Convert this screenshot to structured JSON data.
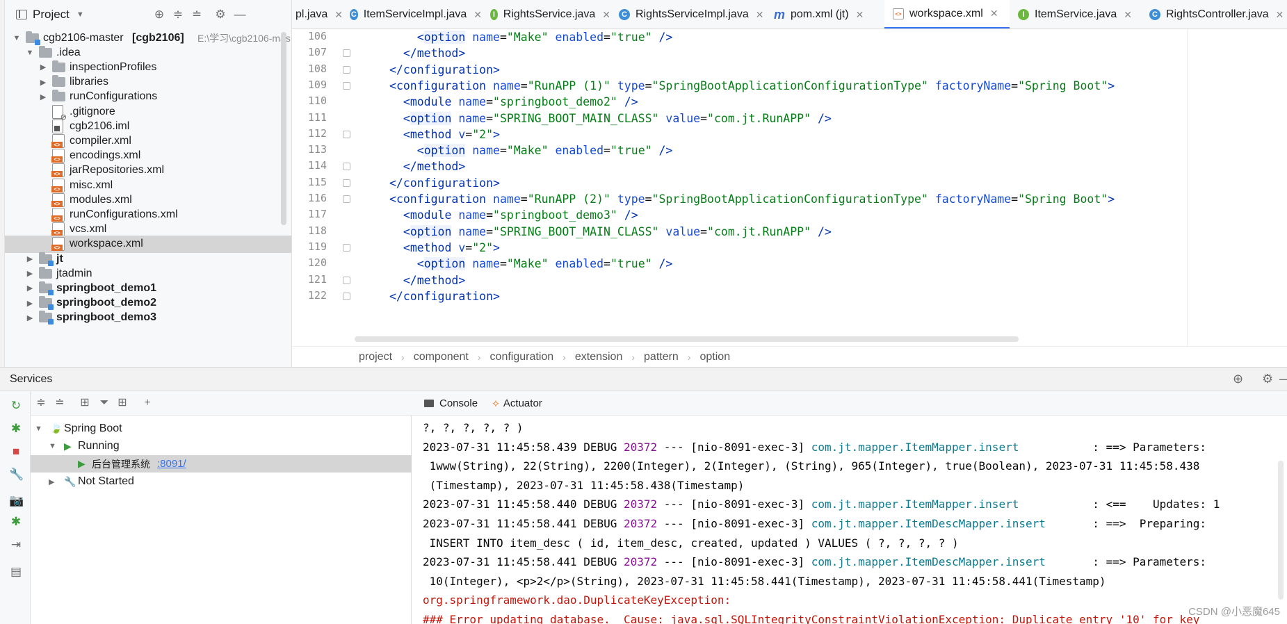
{
  "project_panel": {
    "title": "Project",
    "tree": [
      {
        "label": "cgb2106-master",
        "bold_suffix": "[cgb2106]",
        "path": "E:\\学习\\cgb2106-mas",
        "expanded": true
      },
      {
        "label": ".idea",
        "expanded": true
      },
      {
        "label": "inspectionProfiles"
      },
      {
        "label": "libraries"
      },
      {
        "label": "runConfigurations"
      },
      {
        "label": ".gitignore"
      },
      {
        "label": "cgb2106.iml"
      },
      {
        "label": "compiler.xml"
      },
      {
        "label": "encodings.xml"
      },
      {
        "label": "jarRepositories.xml"
      },
      {
        "label": "misc.xml"
      },
      {
        "label": "modules.xml"
      },
      {
        "label": "runConfigurations.xml"
      },
      {
        "label": "vcs.xml"
      },
      {
        "label": "workspace.xml",
        "selected": true
      },
      {
        "label": "jt"
      },
      {
        "label": "jtadmin"
      },
      {
        "label": "springboot_demo1"
      },
      {
        "label": "springboot_demo2"
      },
      {
        "label": "springboot_demo3"
      }
    ]
  },
  "tabs": [
    {
      "label": "pl.java",
      "icon": ""
    },
    {
      "label": "ItemServiceImpl.java",
      "icon": "C"
    },
    {
      "label": "RightsService.java",
      "icon": "I"
    },
    {
      "label": "RightsServiceImpl.java",
      "icon": "C"
    },
    {
      "label": "pom.xml (jt)",
      "icon": "m"
    },
    {
      "label": "workspace.xml",
      "icon": "xml",
      "active": true
    },
    {
      "label": "ItemService.java",
      "icon": "I"
    },
    {
      "label": "RightsController.java",
      "icon": "C"
    }
  ],
  "editor": {
    "line_numbers": [
      "106",
      "107",
      "108",
      "109",
      "110",
      "111",
      "112",
      "113",
      "114",
      "115",
      "116",
      "117",
      "118",
      "119",
      "120",
      "121",
      "122"
    ],
    "lines": [
      "    <option name=\"Make\" enabled=\"true\" />",
      "  </method>",
      "</configuration>",
      "<configuration name=\"RunAPP (1)\" type=\"SpringBootApplicationConfigurationType\" factoryName=\"Spring Boot\">",
      "  <module name=\"springboot_demo2\" />",
      "  <option name=\"SPRING_BOOT_MAIN_CLASS\" value=\"com.jt.RunAPP\" />",
      "  <method v=\"2\">",
      "    <option name=\"Make\" enabled=\"true\" />",
      "  </method>",
      "</configuration>",
      "<configuration name=\"RunAPP (2)\" type=\"SpringBootApplicationConfigurationType\" factoryName=\"Spring Boot\">",
      "  <module name=\"springboot_demo3\" />",
      "  <option name=\"SPRING_BOOT_MAIN_CLASS\" value=\"com.jt.RunAPP\" />",
      "  <method v=\"2\">",
      "    <option name=\"Make\" enabled=\"true\" />",
      "  </method>",
      "</configuration>"
    ]
  },
  "breadcrumbs": [
    "project",
    "component",
    "configuration",
    "extension",
    "pattern",
    "option"
  ],
  "services": {
    "title": "Services",
    "tree": [
      {
        "label": "Spring Boot"
      },
      {
        "label": "Running"
      },
      {
        "label": "后台管理系统",
        "port": ":8091/"
      },
      {
        "label": "Not Started"
      }
    ]
  },
  "console": {
    "tabs": [
      "Console",
      "Actuator"
    ],
    "lines": [
      [
        {
          "c": "dbg",
          "t": "?, ?, ?, ?, ? )"
        }
      ],
      [
        {
          "c": "dbg",
          "t": "2023-07-31 11:45:58.439 DEBUG "
        },
        {
          "c": "pid",
          "t": "20372"
        },
        {
          "c": "dbg",
          "t": " --- [nio-8091-exec-3] "
        },
        {
          "c": "lg",
          "t": "com.jt.mapper.ItemMapper.insert          "
        },
        {
          "c": "dbg",
          "t": " : ==> Parameters:"
        }
      ],
      [
        {
          "c": "dbg",
          "t": " 1www(String), 22(String), 2200(Integer), 2(Integer), (String), 965(Integer), true(Boolean), 2023-07-31 11:45:58.438"
        }
      ],
      [
        {
          "c": "dbg",
          "t": " (Timestamp), 2023-07-31 11:45:58.438(Timestamp)"
        }
      ],
      [
        {
          "c": "dbg",
          "t": "2023-07-31 11:45:58.440 DEBUG "
        },
        {
          "c": "pid",
          "t": "20372"
        },
        {
          "c": "dbg",
          "t": " --- [nio-8091-exec-3] "
        },
        {
          "c": "lg",
          "t": "com.jt.mapper.ItemMapper.insert          "
        },
        {
          "c": "dbg",
          "t": " : <==    Updates: 1"
        }
      ],
      [
        {
          "c": "dbg",
          "t": "2023-07-31 11:45:58.441 DEBUG "
        },
        {
          "c": "pid",
          "t": "20372"
        },
        {
          "c": "dbg",
          "t": " --- [nio-8091-exec-3] "
        },
        {
          "c": "lg",
          "t": "com.jt.mapper.ItemDescMapper.insert      "
        },
        {
          "c": "dbg",
          "t": " : ==>  Preparing:"
        }
      ],
      [
        {
          "c": "dbg",
          "t": " INSERT INTO item_desc ( id, item_desc, created, updated ) VALUES ( ?, ?, ?, ? )"
        }
      ],
      [
        {
          "c": "dbg",
          "t": "2023-07-31 11:45:58.441 DEBUG "
        },
        {
          "c": "pid",
          "t": "20372"
        },
        {
          "c": "dbg",
          "t": " --- [nio-8091-exec-3] "
        },
        {
          "c": "lg",
          "t": "com.jt.mapper.ItemDescMapper.insert      "
        },
        {
          "c": "dbg",
          "t": " : ==> Parameters:"
        }
      ],
      [
        {
          "c": "dbg",
          "t": " 10(Integer), <p>2</p>(String), 2023-07-31 11:45:58.441(Timestamp), 2023-07-31 11:45:58.441(Timestamp)"
        }
      ],
      [
        {
          "c": "err",
          "t": "org.springframework.dao.DuplicateKeyException:"
        }
      ],
      [
        {
          "c": "err",
          "t": "### Error updating database.  Cause: java.sql.SQLIntegrityConstraintViolationException: Duplicate entry '10' for key"
        }
      ]
    ]
  },
  "watermark": "CSDN @小恶魔645",
  "colors": {
    "accent": "#3574f0",
    "run_green": "#3d9c3d",
    "stop_red": "#d94646"
  }
}
